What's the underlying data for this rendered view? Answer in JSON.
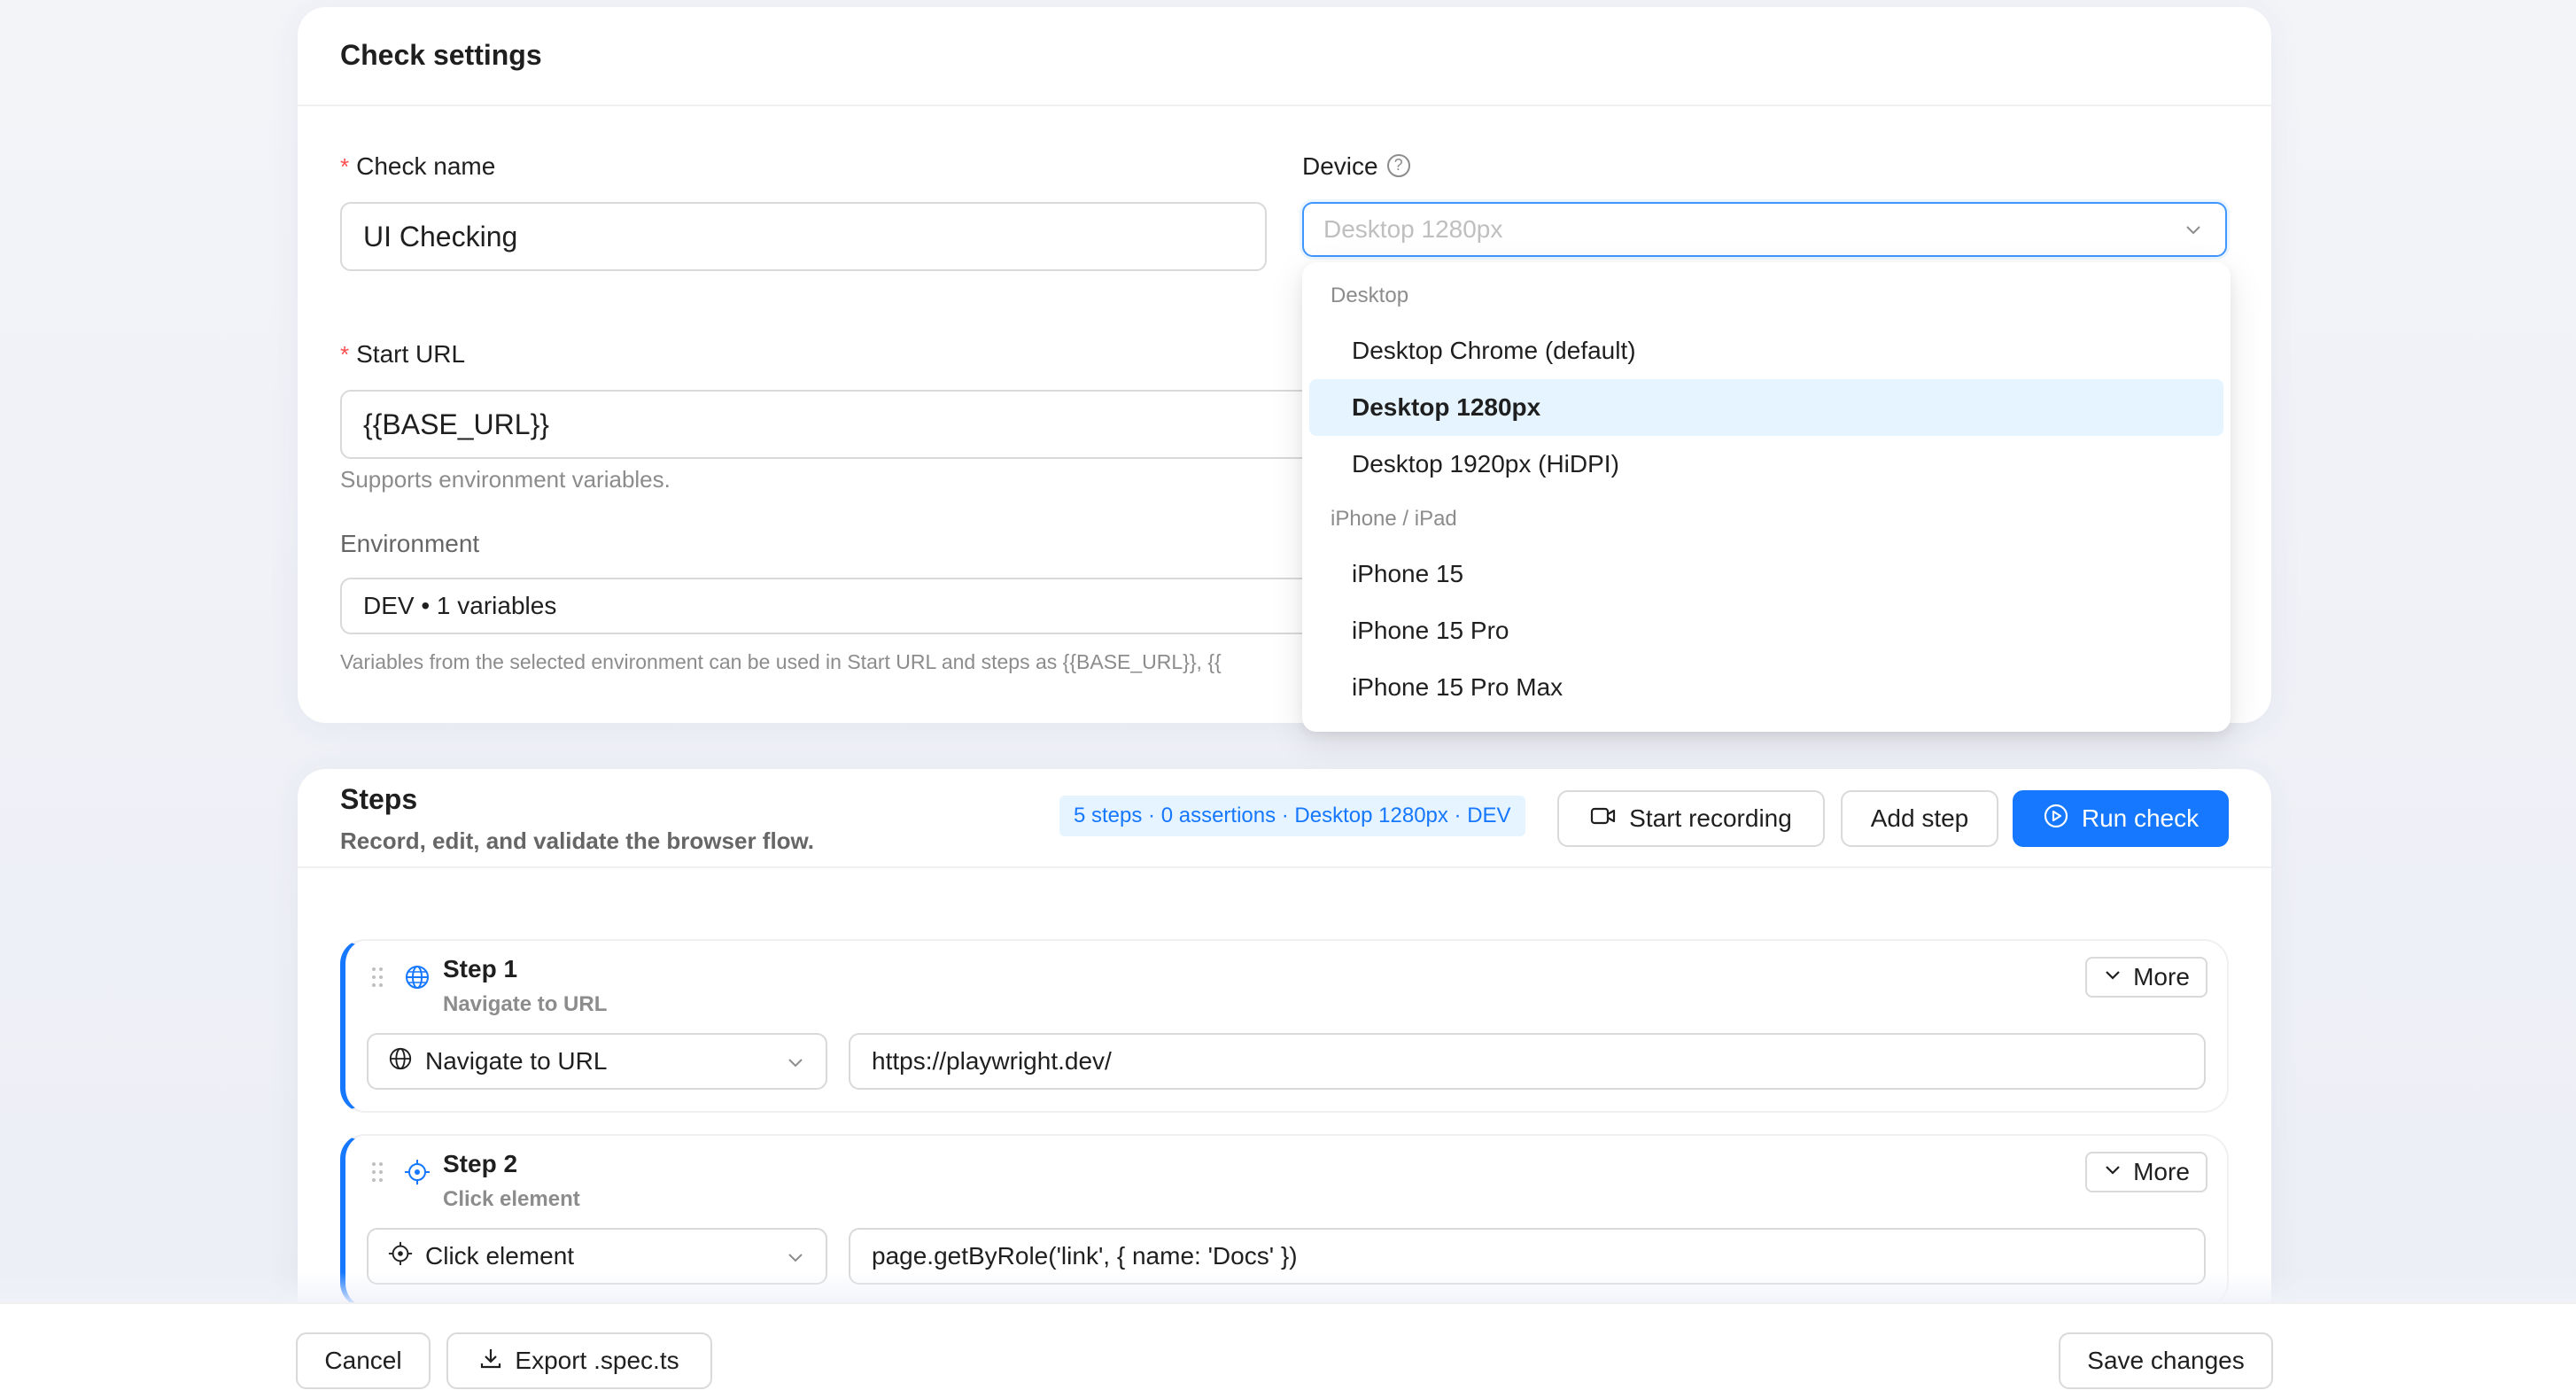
{
  "settings": {
    "title": "Check settings",
    "check_name_label": "Check name",
    "check_name_value": "UI Checking",
    "start_url_label": "Start URL",
    "start_url_value": "{{BASE_URL}}",
    "start_url_help": "Supports environment variables.",
    "environment_label": "Environment",
    "environment_value": "DEV • 1 variables",
    "environment_help": "Variables from the selected environment can be used in Start URL and steps as {{BASE_URL}}, {{",
    "device_label": "Device",
    "device_help_icon": "question-circle-icon",
    "device_placeholder": "Desktop 1280px"
  },
  "device_dropdown": {
    "groups": [
      {
        "label": "Desktop",
        "options": [
          "Desktop Chrome (default)",
          "Desktop 1280px",
          "Desktop 1920px (HiDPI)"
        ]
      },
      {
        "label": "iPhone / iPad",
        "options": [
          "iPhone 15",
          "iPhone 15 Pro",
          "iPhone 15 Pro Max"
        ]
      }
    ],
    "selected": "Desktop 1280px"
  },
  "steps": {
    "title": "Steps",
    "subtitle": "Record, edit, and validate the browser flow.",
    "summary": "5 steps · 0 assertions · Desktop 1280px · DEV",
    "start_recording_label": "Start recording",
    "add_step_label": "Add step",
    "run_check_label": "Run check",
    "items": [
      {
        "title": "Step 1",
        "subtitle": "Navigate to URL",
        "action": "Navigate to URL",
        "value": "https://playwright.dev/",
        "icon": "globe-icon",
        "more_label": "More"
      },
      {
        "title": "Step 2",
        "subtitle": "Click element",
        "action": "Click element",
        "value": "page.getByRole('link', { name: 'Docs' })",
        "icon": "aim-icon",
        "more_label": "More"
      }
    ]
  },
  "footer": {
    "cancel_label": "Cancel",
    "export_label": "Export .spec.ts",
    "save_label": "Save changes"
  },
  "colors": {
    "primary": "#1677ff",
    "required": "#ff4d4f",
    "selected_bg": "#e6f4ff"
  }
}
